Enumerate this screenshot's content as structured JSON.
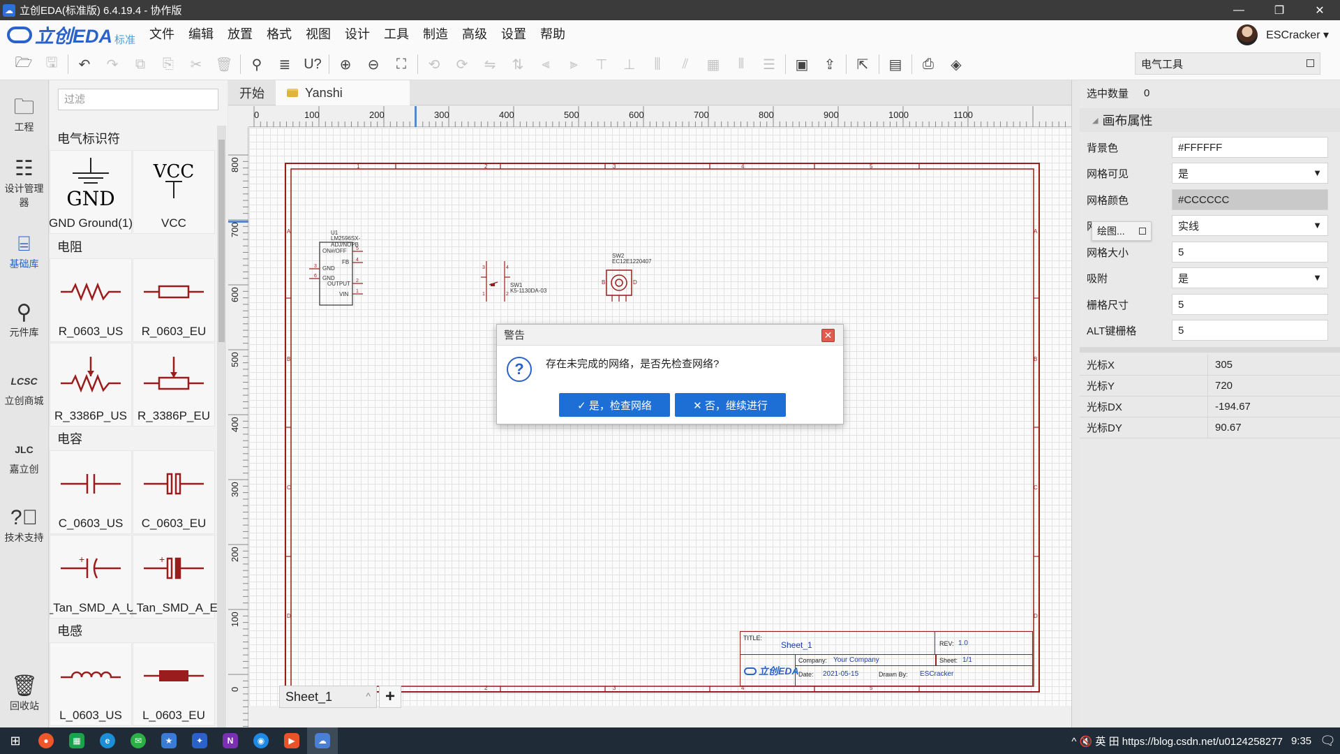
{
  "window": {
    "title": "立创EDA(标准版) 6.4.19.4 - 协作版",
    "min": "—",
    "max": "❐",
    "close": "✕"
  },
  "app": {
    "logo": "立创EDA",
    "edition": "标准"
  },
  "menu": [
    "文件",
    "编辑",
    "放置",
    "格式",
    "视图",
    "设计",
    "工具",
    "制造",
    "高级",
    "设置",
    "帮助"
  ],
  "user": {
    "name": "ESCracker ▾"
  },
  "elec_tools": {
    "label": "电气工具"
  },
  "left_nav": [
    {
      "label": "工程",
      "icon": "folder-icon"
    },
    {
      "label": "设计管理器",
      "icon": "list-icon"
    },
    {
      "label": "基础库",
      "icon": "chip-icon"
    },
    {
      "label": "元件库",
      "icon": "search-icon"
    },
    {
      "label": "立创商城",
      "icon": "lcsc-icon"
    },
    {
      "label": "嘉立创",
      "icon": "jlc-icon"
    },
    {
      "label": "技术支持",
      "icon": "help-icon"
    },
    {
      "label": "回收站",
      "icon": "trash-icon"
    }
  ],
  "library": {
    "filter_placeholder": "过滤",
    "categories": [
      "电气标识符",
      "电阻",
      "电容",
      "电感"
    ],
    "items": [
      "GND Ground(1)",
      "VCC",
      "R_0603_US",
      "R_0603_EU",
      "R_3386P_US",
      "R_3386P_EU",
      "C_0603_US",
      "C_0603_EU",
      "_Tan_SMD_A_U",
      "_Tan_SMD_A_E",
      "L_0603_US",
      "L_0603_EU"
    ]
  },
  "tabs": [
    {
      "label": "开始"
    },
    {
      "label": "Yanshi"
    }
  ],
  "ruler_x": [
    "0",
    "100",
    "200",
    "300",
    "400",
    "500",
    "600",
    "700",
    "800",
    "900",
    "1000",
    "1100"
  ],
  "ruler_y": [
    "800",
    "700",
    "600",
    "500",
    "400",
    "300",
    "200",
    "100",
    "0"
  ],
  "sheet": {
    "tab": "Sheet_1",
    "add": "+",
    "up": "^"
  },
  "title_block": {
    "title_label": "TITLE:",
    "title": "Sheet_1",
    "rev_label": "REV:",
    "rev": "1.0",
    "company_label": "Company:",
    "company": "Your Company",
    "sheet_label": "Sheet:",
    "sheet": "1/1",
    "date_label": "Date:",
    "date": "2021-05-15",
    "drawn_label": "Drawn By:",
    "drawn_by": "ESCracker",
    "logo": "立创EDA"
  },
  "frame_cols": [
    "1",
    "2",
    "3",
    "4",
    "5"
  ],
  "frame_rows": [
    "A",
    "B",
    "C",
    "D"
  ],
  "parts": {
    "u1_ref": "U1",
    "u1_name": "LM2596SX-ADJ/NOPB",
    "u1_pins_left": [
      "GND",
      "GND"
    ],
    "u1_pins_left_num": [
      "3",
      "6"
    ],
    "u1_pins_right": [
      "ON#/OFF",
      "FB",
      "OUTPUT",
      "VIN"
    ],
    "u1_pins_right_num": [
      "5",
      "4",
      "2",
      "1"
    ],
    "sw1_ref": "SW1",
    "sw1_name": "K5-1130DA-03",
    "sw1_pins": [
      "3",
      "4",
      "1",
      "2"
    ],
    "sw2_ref": "SW2",
    "sw2_name": "EC12E1220407",
    "sw2_pins": [
      "B",
      "D"
    ]
  },
  "props": {
    "selected_label": "选中数量",
    "selected_value": "0",
    "section": "画布属性",
    "rows": [
      {
        "label": "背景色",
        "value": "#FFFFFF",
        "dropdown": false
      },
      {
        "label": "网格可见",
        "value": "是",
        "dropdown": true
      },
      {
        "label": "网格颜色",
        "value": "#CCCCCC",
        "dropdown": false
      },
      {
        "label": "网",
        "value": "实线",
        "dropdown": true
      },
      {
        "label": "网格大小",
        "value": "5",
        "dropdown": false
      },
      {
        "label": "吸附",
        "value": "是",
        "dropdown": true
      },
      {
        "label": "栅格尺寸",
        "value": "5",
        "dropdown": false
      },
      {
        "label": "ALT键栅格",
        "value": "5",
        "dropdown": false
      }
    ],
    "cursor": [
      {
        "k": "光标X",
        "v": "305"
      },
      {
        "k": "光标Y",
        "v": "720"
      },
      {
        "k": "光标DX",
        "v": "-194.67"
      },
      {
        "k": "光标DY",
        "v": "90.67"
      }
    ]
  },
  "float_panel": {
    "label": "绘图..."
  },
  "dialog": {
    "title": "警告",
    "message": "存在未完成的网络，是否先检查网络?",
    "yes": "✓ 是，检查网络",
    "no": "✕ 否，继续进行"
  },
  "taskbar": {
    "tray_text": "^ 🔇 英 田 https://blog.csdn.net/u0124258277",
    "time": "9:35"
  },
  "colors": {
    "accent": "#2a62c9",
    "button": "#1d6fd6",
    "schematic": "#9b1c1c",
    "close": "#e05a4e"
  }
}
